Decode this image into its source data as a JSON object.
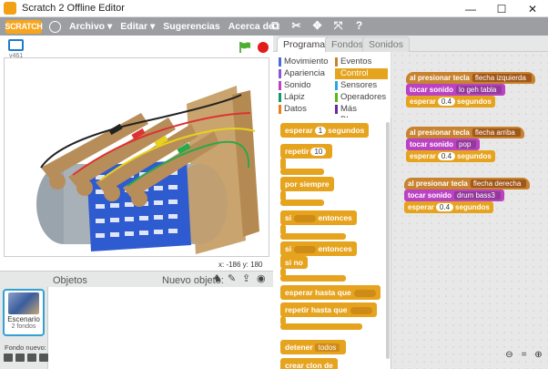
{
  "window": {
    "title": "Scratch 2 Offline Editor",
    "minimize": "—",
    "maximize": "☐",
    "close": "✕"
  },
  "menubar": {
    "logo_text": "SCRATCH",
    "items": [
      "Archivo ▾",
      "Editar ▾",
      "Sugerencias",
      "Acerca de"
    ]
  },
  "stage": {
    "version": "v461",
    "coords": "x: -186  y: 180"
  },
  "sprites": {
    "objetos_label": "Objetos",
    "nuevo_objeto_label": "Nuevo objeto:",
    "stage_thumb_label": "Escenario",
    "stage_thumb_sub": "2 fondos",
    "fondo_nuevo_label": "Fondo nuevo:"
  },
  "tabs": [
    "Programas",
    "Fondos",
    "Sonidos"
  ],
  "categories": {
    "left": [
      {
        "label": "Movimiento",
        "color": "#4a6cd4"
      },
      {
        "label": "Apariencia",
        "color": "#8a55d7"
      },
      {
        "label": "Sonido",
        "color": "#bb42c3"
      },
      {
        "label": "Lápiz",
        "color": "#0e9a6c"
      },
      {
        "label": "Datos",
        "color": "#ee7d16"
      }
    ],
    "right": [
      {
        "label": "Eventos",
        "color": "#c88330"
      },
      {
        "label": "Control",
        "color": "#e1a91a"
      },
      {
        "label": "Sensores",
        "color": "#2ca5e2"
      },
      {
        "label": "Operadores",
        "color": "#5cb712"
      },
      {
        "label": "Más Bloques",
        "color": "#632d99"
      }
    ]
  },
  "palette": {
    "wait_label": "esperar",
    "wait_value": "1",
    "wait_unit": "segundos",
    "repeat_label": "repetir",
    "repeat_value": "10",
    "forever_label": "por siempre",
    "if_label": "si",
    "then_label": "entonces",
    "ifelse_label": "si",
    "ifelse_then": "entonces",
    "else_label": "si no",
    "wait_until_label": "esperar hasta que",
    "repeat_until_label": "repetir hasta que",
    "stop_label": "detener",
    "stop_value": "todos",
    "clone_label": "crear clon de"
  },
  "scripts": [
    {
      "hat": "al presionar tecla",
      "key": "flecha izquierda",
      "sound_label": "tocar sonido",
      "sound": "lo geh tabla",
      "wait_label": "esperar",
      "wait_value": "0.4",
      "wait_unit": "segundos"
    },
    {
      "hat": "al presionar tecla",
      "key": "flecha arriba",
      "sound_label": "tocar sonido",
      "sound": "pop",
      "wait_label": "esperar",
      "wait_value": "0.4",
      "wait_unit": "segundos"
    },
    {
      "hat": "al presionar tecla",
      "key": "flecha derecha",
      "sound_label": "tocar sonido",
      "sound": "drum bass3",
      "wait_label": "esperar",
      "wait_value": "0.4",
      "wait_unit": "segundos"
    }
  ],
  "colors": {
    "accent": "#e6a31e",
    "menubar": "#9c9ea2",
    "events": "#c88330",
    "sound": "#bb42c3"
  }
}
